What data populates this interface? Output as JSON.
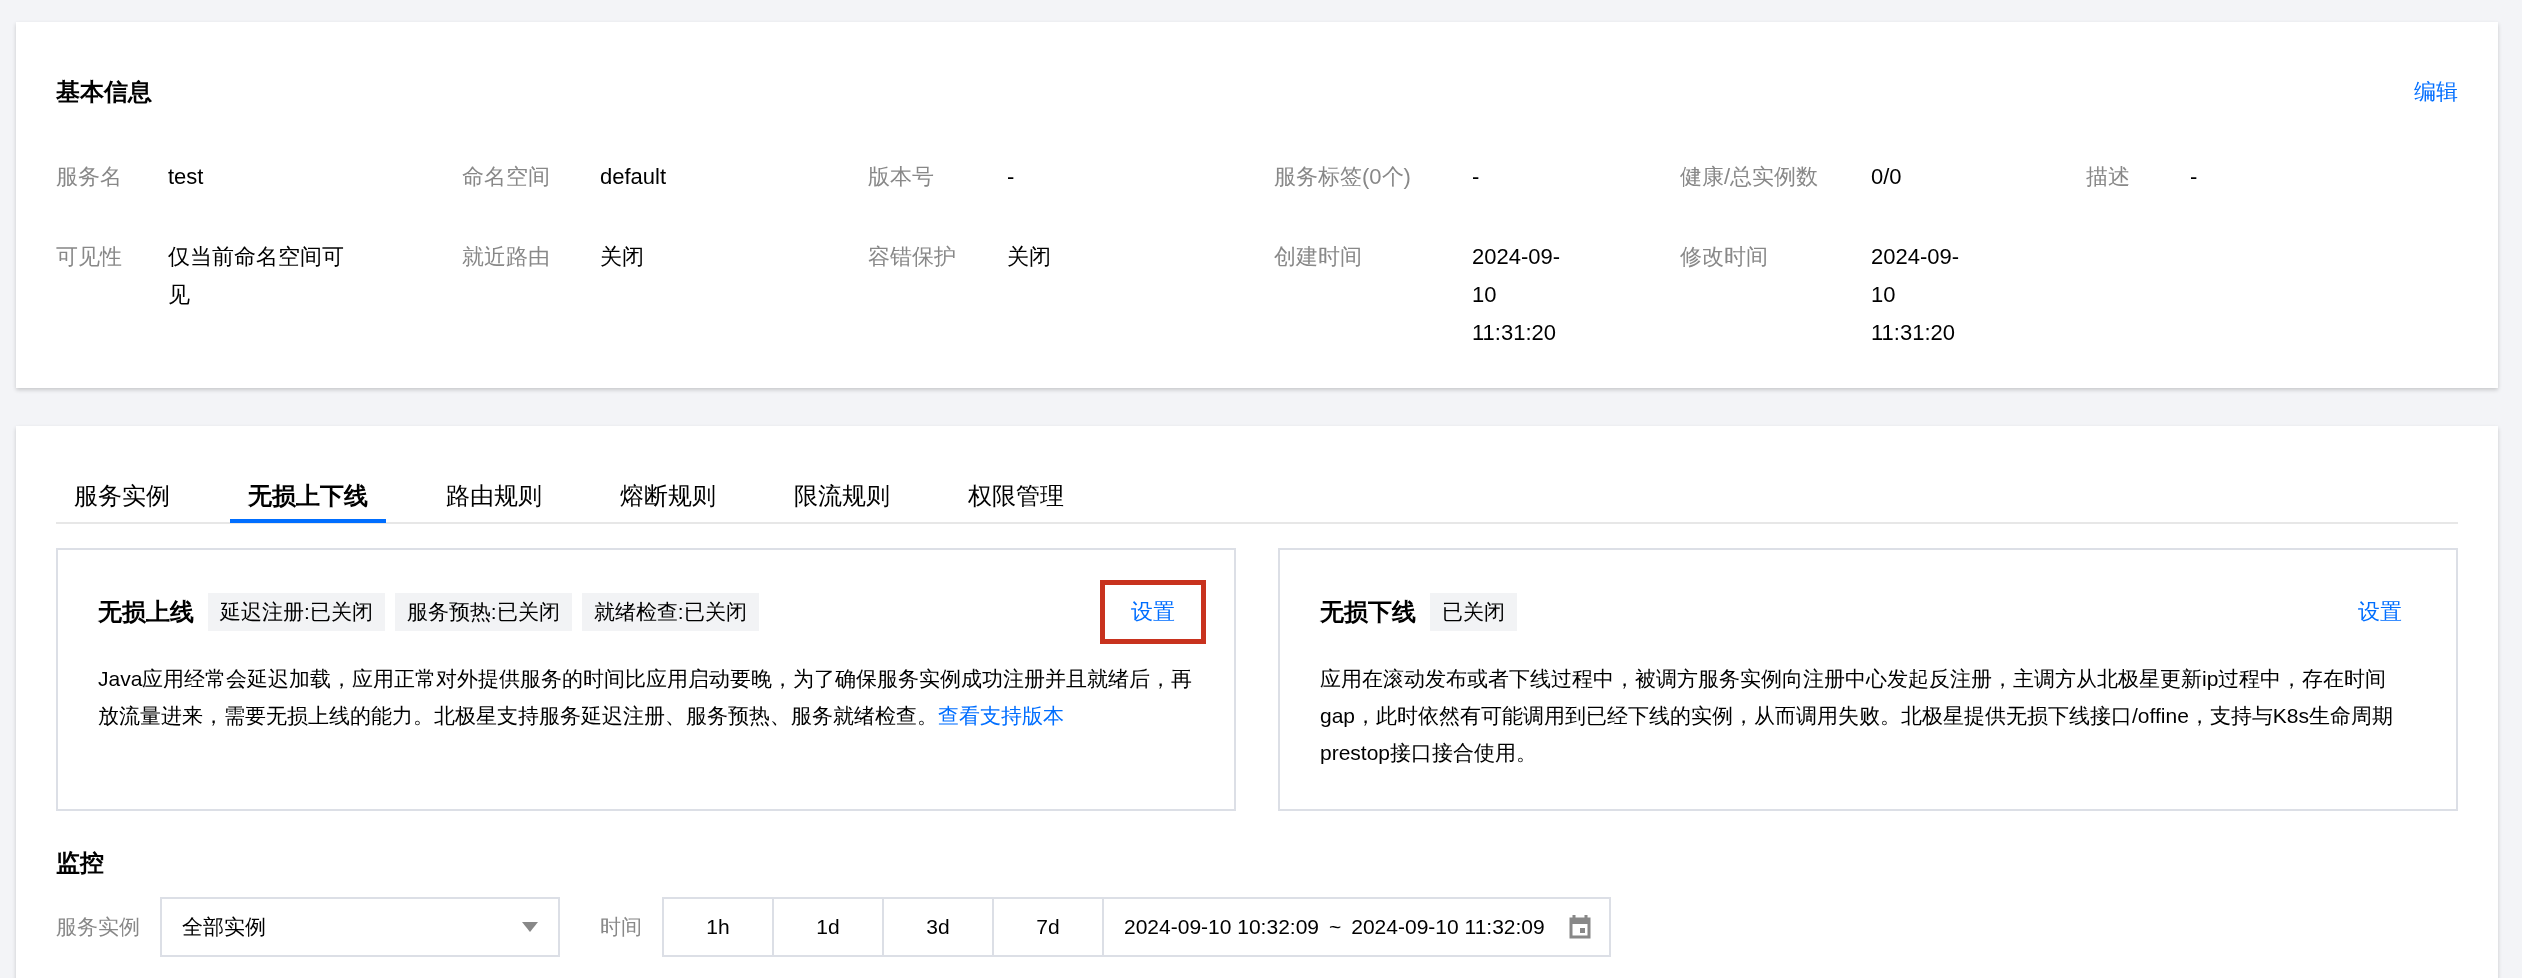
{
  "basic_info": {
    "title": "基本信息",
    "edit_link": "编辑",
    "fields": [
      {
        "label": "服务名",
        "value": "test"
      },
      {
        "label": "命名空间",
        "value": "default"
      },
      {
        "label": "版本号",
        "value": "-"
      },
      {
        "label": "服务标签(0个)",
        "value": "-"
      },
      {
        "label": "健康/总实例数",
        "value": "0/0"
      },
      {
        "label": "描述",
        "value": "-"
      },
      {
        "label": "可见性",
        "value": "仅当前命名空间可见"
      },
      {
        "label": "就近路由",
        "value": "关闭"
      },
      {
        "label": "容错保护",
        "value": "关闭"
      },
      {
        "label": "创建时间",
        "value": "2024-09-10 11:31:20"
      },
      {
        "label": "修改时间",
        "value": "2024-09-10 11:31:20"
      }
    ]
  },
  "tabs": [
    {
      "label": "服务实例",
      "selected": false
    },
    {
      "label": "无损上下线",
      "selected": true
    },
    {
      "label": "路由规则",
      "selected": false
    },
    {
      "label": "熔断规则",
      "selected": false
    },
    {
      "label": "限流规则",
      "selected": false
    },
    {
      "label": "权限管理",
      "selected": false
    }
  ],
  "panels": [
    {
      "title": "无损上线",
      "tags": [
        "延迟注册:已关闭",
        "服务预热:已关闭",
        "就绪检查:已关闭"
      ],
      "settings_link": "设置",
      "highlighted": true,
      "description": "Java应用经常会延迟加载，应用正常对外提供服务的时间比应用启动要晚，为了确保服务实例成功注册并且就绪后，再放流量进来，需要无损上线的能力。北极星支持服务延迟注册、服务预热、服务就绪检查。",
      "link": "查看支持版本"
    },
    {
      "title": "无损下线",
      "tags": [
        "已关闭"
      ],
      "settings_link": "设置",
      "highlighted": false,
      "description": "应用在滚动发布或者下线过程中，被调方服务实例向注册中心发起反注册，主调方从北极星更新ip过程中，存在时间gap，此时依然有可能调用到已经下线的实例，从而调用失败。北极星提供无损下线接口/offine，支持与K8s生命周期prestop接口接合使用。"
    }
  ],
  "monitor": {
    "title": "监控",
    "instance_label": "服务实例",
    "instance_select": "全部实例",
    "time_label": "时间",
    "ranges": [
      "1h",
      "1d",
      "3d",
      "7d"
    ],
    "start": "2024-09-10 10:32:09",
    "separator": "~",
    "end": "2024-09-10 11:32:09"
  }
}
